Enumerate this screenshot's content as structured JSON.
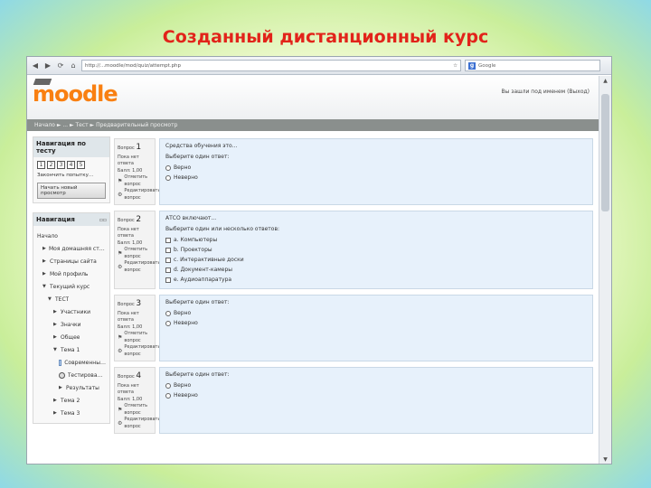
{
  "slide": {
    "title": "Созданный дистанционный курс"
  },
  "browser": {
    "back_icon": "arrow-left-icon",
    "forward_icon": "arrow-right-icon",
    "reload_icon": "reload-icon",
    "home_icon": "home-icon",
    "url": "http://...moodle/mod/quiz/attempt.php",
    "search_placeholder": "Google",
    "search_badge": "g"
  },
  "moodle": {
    "logo": "moodle",
    "login_info": "Вы зашли под именем (Выход)",
    "breadcrumb": "Начало ► ... ► Тест ► Предварительный просмотр"
  },
  "quiz_nav": {
    "title": "Навигация по тесту",
    "numbers": [
      "1",
      "2",
      "3",
      "4",
      "5"
    ],
    "finish_link": "Закончить попытку...",
    "start_new": "Начать новый просмотр"
  },
  "navigation": {
    "title": "Навигация",
    "items": [
      {
        "label": "Начало",
        "level": 0,
        "icon": ""
      },
      {
        "label": "Моя домашняя страница",
        "level": 1,
        "icon": "triangle-right"
      },
      {
        "label": "Страницы сайта",
        "level": 1,
        "icon": "triangle-right"
      },
      {
        "label": "Мой профиль",
        "level": 1,
        "icon": "triangle-right"
      },
      {
        "label": "Текущий курс",
        "level": 1,
        "icon": "triangle-down"
      },
      {
        "label": "ТЕСТ",
        "level": 2,
        "icon": "triangle-down"
      },
      {
        "label": "Участники",
        "level": 3,
        "icon": "triangle-right"
      },
      {
        "label": "Значки",
        "level": 3,
        "icon": "triangle-right"
      },
      {
        "label": "Общее",
        "level": 3,
        "icon": "triangle-right"
      },
      {
        "label": "Тема 1",
        "level": 3,
        "icon": "triangle-down"
      },
      {
        "label": "Современные технические средства обучения",
        "level": 4,
        "icon": "doc"
      },
      {
        "label": "Тестирование",
        "level": 4,
        "icon": "quiz"
      },
      {
        "label": "Результаты",
        "level": 4,
        "icon": "triangle-right"
      },
      {
        "label": "Тема 2",
        "level": 3,
        "icon": "triangle-right"
      },
      {
        "label": "Тема 3",
        "level": 3,
        "icon": "triangle-right"
      }
    ]
  },
  "qinfo_labels": {
    "question": "Вопрос",
    "not_answered": "Пока нет ответа",
    "marks": "Балл: 1,00",
    "flag": "Отметить вопрос",
    "edit": "Редактировать вопрос"
  },
  "questions": [
    {
      "number": "1",
      "text": "Средства обучения это...",
      "prompt": "Выберите один ответ:",
      "type": "radio",
      "options": [
        "Верно",
        "Неверно"
      ]
    },
    {
      "number": "2",
      "text": "АТСО включают...",
      "prompt": "Выберите один или несколько ответов:",
      "type": "checkbox",
      "options": [
        "a. Компьютеры",
        "b. Проекторы",
        "c. Интерактивные доски",
        "d. Документ-камеры",
        "e. Аудиоаппаратура"
      ]
    },
    {
      "number": "3",
      "text": "",
      "prompt": "Выберите один ответ:",
      "type": "radio",
      "options": [
        "Верно",
        "Неверно"
      ]
    },
    {
      "number": "4",
      "text": "",
      "prompt": "Выберите один ответ:",
      "type": "radio",
      "options": [
        "Верно",
        "Неверно"
      ]
    }
  ],
  "colors": {
    "title": "#e2231a",
    "logo": "#f98012",
    "question_bg": "#e7f1fb"
  }
}
